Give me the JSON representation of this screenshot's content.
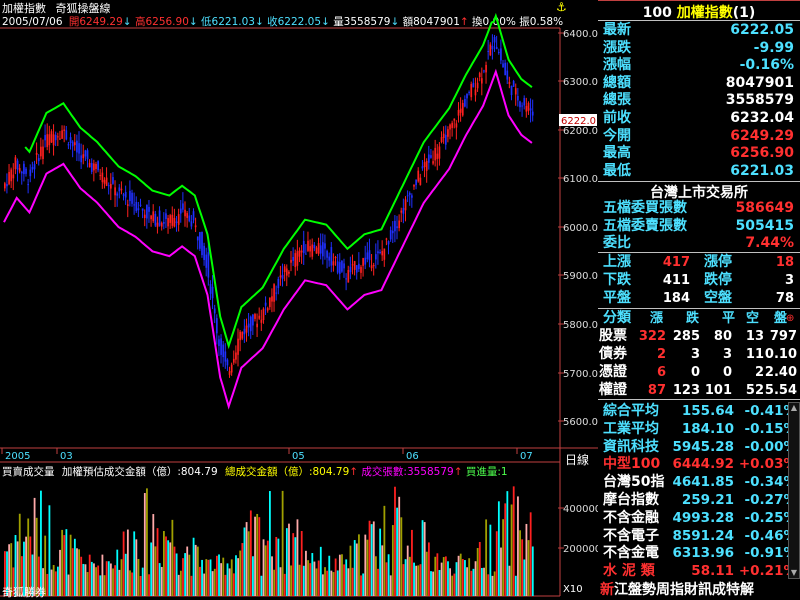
{
  "chart_header": {
    "title": "加權指數",
    "indicator": "奇狐操盤線",
    "date": "2005/07/06",
    "open": "開6249.29",
    "high": "高6256.90",
    "low": "低6221.03",
    "close": "收6222.05",
    "volume": "量3558579",
    "amount": "額8047901",
    "turnover": "換0.00%",
    "amplitude": "振0.58%"
  },
  "price_axis": [
    "6400.0",
    "6300.0",
    "6200.0",
    "6100.0",
    "6000.0",
    "5900.0",
    "5800.0",
    "5700.0",
    "5600.0"
  ],
  "current_price_tag": "6222.0",
  "date_axis": [
    "2005",
    "03",
    "05",
    "06",
    "07"
  ],
  "period_label": "日線",
  "volume_header": {
    "label": "買賣成交量",
    "item1": "加權預估成交金額（億）:804.79",
    "item2": "總成交金額（億）:804.79",
    "item3": "成交張數:3558579",
    "item4": "買進量:1"
  },
  "volume_axis": [
    "400000",
    "200000"
  ],
  "volume_unit": "X10",
  "footer_left": "奇狐勝券",
  "panel": {
    "title_code": "100",
    "title_name": "加權指數",
    "title_suffix": "(1)",
    "quotes": [
      {
        "k": "最新",
        "v": "6222.05",
        "c": "cyan"
      },
      {
        "k": "漲跌",
        "v": "-9.99",
        "c": "cyan"
      },
      {
        "k": "漲幅",
        "v": "-0.16%",
        "c": "cyan"
      },
      {
        "k": "總額",
        "v": "8047901",
        "c": "white"
      },
      {
        "k": "總張",
        "v": "3558579",
        "c": "white"
      },
      {
        "k": "前收",
        "v": "6232.04",
        "c": "white"
      },
      {
        "k": "今開",
        "v": "6249.29",
        "c": "red"
      },
      {
        "k": "最高",
        "v": "6256.90",
        "c": "red"
      },
      {
        "k": "最低",
        "v": "6221.03",
        "c": "cyan"
      }
    ],
    "exchange": "台灣上市交易所",
    "depth": [
      {
        "k": "五檔委買張數",
        "v": "586649",
        "c": "red"
      },
      {
        "k": "五檔委賣張數",
        "v": "505415",
        "c": "cyan"
      },
      {
        "k": "委比",
        "v": "7.44%",
        "c": "red"
      }
    ],
    "breadth": [
      {
        "k1": "上漲",
        "v1": "417",
        "c1": "red",
        "k2": "漲停",
        "v2": "18",
        "c2": "red"
      },
      {
        "k1": "下跌",
        "v1": "411",
        "c1": "white",
        "k2": "跌停",
        "v2": "3",
        "c2": "white"
      },
      {
        "k1": "平盤",
        "v1": "184",
        "c1": "white",
        "k2": "空盤",
        "v2": "78",
        "c2": "white"
      }
    ],
    "class_header": [
      "分類",
      "漲",
      "跌",
      "平",
      "空",
      "盤"
    ],
    "classes": [
      {
        "name": "股票",
        "up": "322",
        "down": "285",
        "flat": "80",
        "empty": "13",
        "ratio": "797"
      },
      {
        "name": "債券",
        "up": "2",
        "down": "3",
        "flat": "3",
        "empty": "11",
        "ratio": "0.10"
      },
      {
        "name": "憑證",
        "up": "6",
        "down": "0",
        "flat": "0",
        "empty": "2",
        "ratio": "2.40"
      },
      {
        "name": "權證",
        "up": "87",
        "down": "123",
        "flat": "101",
        "empty": "52",
        "ratio": "5.54"
      }
    ],
    "indices": [
      {
        "k": "綜合平均",
        "v": "155.64",
        "p": "-0.41%",
        "kc": "cyan",
        "vc": "cyan"
      },
      {
        "k": "工業平均",
        "v": "184.10",
        "p": "-0.15%",
        "kc": "cyan",
        "vc": "cyan"
      },
      {
        "k": "資訊科技",
        "v": "5945.28",
        "p": "-0.00%",
        "kc": "cyan",
        "vc": "cyan"
      },
      {
        "k": "中型100",
        "v": "6444.92",
        "p": "+0.03%",
        "kc": "red",
        "vc": "red"
      },
      {
        "k": "台灣50指",
        "v": "4641.85",
        "p": "-0.34%",
        "kc": "white",
        "vc": "cyan"
      },
      {
        "k": "摩台指數",
        "v": "259.21",
        "p": "-0.27%",
        "kc": "white",
        "vc": "cyan"
      },
      {
        "k": "不含金融",
        "v": "4993.28",
        "p": "-0.25%",
        "kc": "white",
        "vc": "cyan"
      },
      {
        "k": "不含電子",
        "v": "8591.24",
        "p": "-0.46%",
        "kc": "white",
        "vc": "cyan"
      },
      {
        "k": "不含金電",
        "v": "6313.96",
        "p": "-0.91%",
        "kc": "white",
        "vc": "cyan"
      },
      {
        "k": "水 泥 類",
        "v": "58.11",
        "p": "+0.21%",
        "kc": "red",
        "vc": "red"
      }
    ],
    "marquee_tag": "新",
    "marquee": "江盤勢周指財訊成特解"
  },
  "colors": {
    "up": "#ff2020",
    "down": "#2030ff",
    "upper_line": "#00ff00",
    "lower_line": "#ff00ff",
    "axis": "#c04040"
  }
}
